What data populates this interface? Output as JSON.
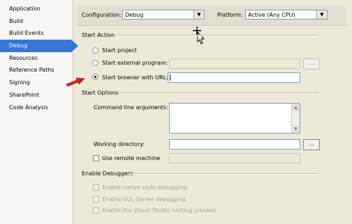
{
  "sidebar": {
    "items": [
      {
        "label": "Application"
      },
      {
        "label": "Build"
      },
      {
        "label": "Build Events"
      },
      {
        "label": "Debug"
      },
      {
        "label": "Resources"
      },
      {
        "label": "Reference Paths"
      },
      {
        "label": "Signing"
      },
      {
        "label": "SharePoint"
      },
      {
        "label": "Code Analysis"
      }
    ],
    "selected": "Debug"
  },
  "toolbar": {
    "configuration_label": "Configuration:",
    "configuration_value": "Debug",
    "platform_label": "Platform:",
    "platform_value": "Active (Any CPU)"
  },
  "start_action": {
    "title": "Start Action",
    "start_project": "Start project",
    "start_external_program": "Start external program:",
    "start_browser_url": "Start browser with URL:",
    "selected": "Start browser with URL:",
    "browse_label": "..."
  },
  "start_options": {
    "title": "Start Options",
    "command_line_label": "Command line arguments:",
    "working_dir_label": "Working directory:",
    "use_remote_machine": "Use remote machine",
    "browse_label": "..."
  },
  "enable_debuggers": {
    "title": "Enable Debuggers",
    "native": "Enable native code debugging",
    "sql": "Enable SQL Server debugging",
    "vs_hosting": "Enable the Visual Studio hosting process"
  },
  "colors": {
    "accent": "#3876d6",
    "arrow": "#e01010"
  }
}
